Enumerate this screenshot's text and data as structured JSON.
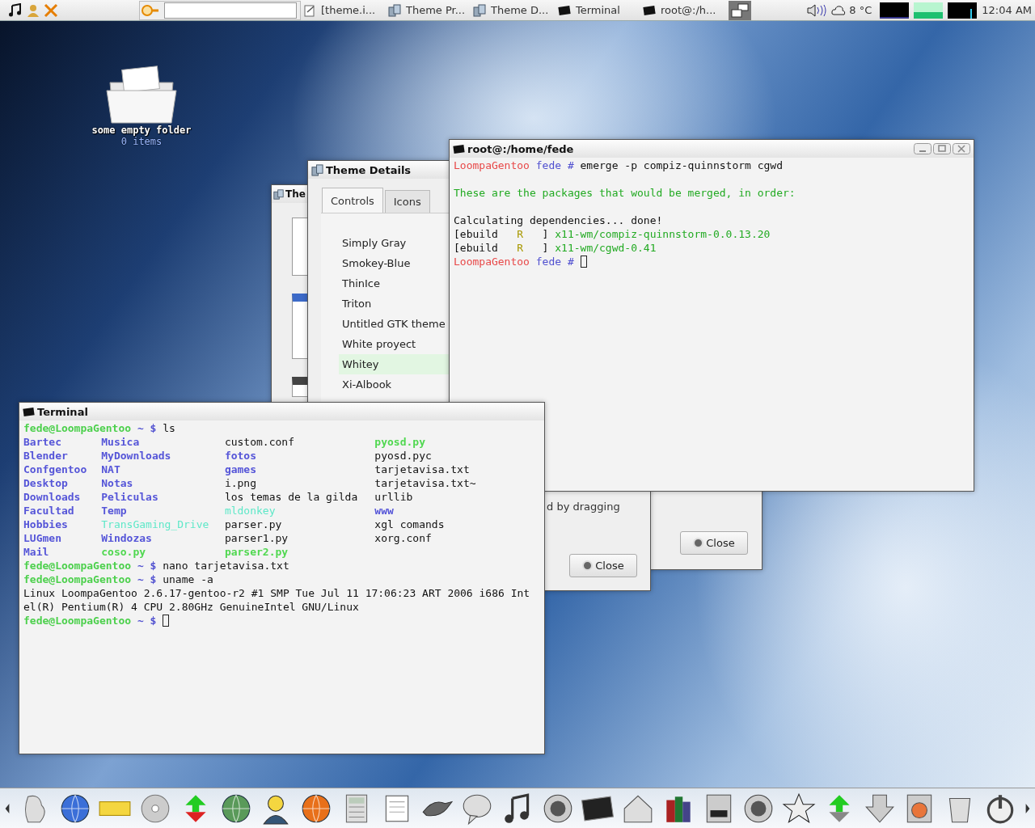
{
  "top_panel": {
    "tasks": [
      {
        "label": "[theme.i..."
      },
      {
        "label": "Theme Pr..."
      },
      {
        "label": "Theme D..."
      },
      {
        "label": "Terminal"
      },
      {
        "label": "root@:/h..."
      }
    ],
    "weather": "8 °C",
    "clock": "12:04 AM"
  },
  "desktop_icons": [
    {
      "label": "some empty folder",
      "detail": "0 items"
    }
  ],
  "theme_properties_window": {
    "title": "The",
    "close_button": "Close"
  },
  "theme_details_window": {
    "title": "Theme Details",
    "tabs": [
      {
        "label": "Controls",
        "selected": true
      },
      {
        "label": "Icons",
        "selected": false
      }
    ],
    "themes": [
      {
        "name": "Simply Gray",
        "selected": false
      },
      {
        "name": "Smokey-Blue",
        "selected": false
      },
      {
        "name": "ThinIce",
        "selected": false
      },
      {
        "name": "Triton",
        "selected": false
      },
      {
        "name": "Untitled GTK theme",
        "selected": false
      },
      {
        "name": "White proyect",
        "selected": false
      },
      {
        "name": "Whitey",
        "selected": true
      },
      {
        "name": "Xi-Albook",
        "selected": false
      }
    ],
    "note_fragment": "d by dragging",
    "close_button": "Close"
  },
  "root_terminal": {
    "title": "root@:/home/fede",
    "lines": [
      {
        "kind": "text",
        "segs": [
          {
            "text": "LoompaGentoo",
            "kind": "host"
          },
          {
            "text": " fede # ",
            "kind": "path"
          },
          {
            "text": "emerge -p compiz-quinnstorm cgwd",
            "kind": "plain"
          }
        ]
      },
      {
        "kind": "blank"
      },
      {
        "kind": "text",
        "segs": [
          {
            "text": "These are the packages that would be merged, in order:",
            "kind": "info"
          }
        ]
      },
      {
        "kind": "blank"
      },
      {
        "kind": "text",
        "segs": [
          {
            "text": "Calculating dependencies... done!",
            "kind": "plain"
          }
        ]
      },
      {
        "kind": "text",
        "segs": [
          {
            "text": "[ebuild   ",
            "kind": "plain"
          },
          {
            "text": "R",
            "kind": "flag"
          },
          {
            "text": "   ] ",
            "kind": "plain"
          },
          {
            "text": "x11-wm/compiz-quinnstorm-0.0.13.20",
            "kind": "pkg"
          }
        ]
      },
      {
        "kind": "text",
        "segs": [
          {
            "text": "[ebuild   ",
            "kind": "plain"
          },
          {
            "text": "R",
            "kind": "flag"
          },
          {
            "text": "   ] ",
            "kind": "plain"
          },
          {
            "text": "x11-wm/cgwd-0.41",
            "kind": "pkg"
          }
        ]
      },
      {
        "kind": "text",
        "cursor": true,
        "segs": [
          {
            "text": "LoompaGentoo",
            "kind": "host"
          },
          {
            "text": " fede # ",
            "kind": "path"
          }
        ]
      }
    ]
  },
  "terminal": {
    "title": "Terminal",
    "lines": [
      {
        "kind": "text",
        "segs": [
          {
            "text": "fede@LoompaGentoo",
            "kind": "user"
          },
          {
            "text": " ~ $ ",
            "kind": "sym"
          },
          {
            "text": "ls",
            "kind": "plain"
          }
        ]
      },
      {
        "kind": "columns",
        "cells": [
          {
            "text": "Bartec",
            "kind": "dir"
          },
          {
            "text": "Musica",
            "kind": "dir"
          },
          {
            "text": "custom.conf",
            "kind": "plain"
          },
          {
            "text": "pyosd.py",
            "kind": "exec"
          }
        ]
      },
      {
        "kind": "columns",
        "cells": [
          {
            "text": "Blender",
            "kind": "dir"
          },
          {
            "text": "MyDownloads",
            "kind": "dir"
          },
          {
            "text": "fotos",
            "kind": "dir"
          },
          {
            "text": "pyosd.pyc",
            "kind": "plain"
          }
        ]
      },
      {
        "kind": "columns",
        "cells": [
          {
            "text": "Confgentoo",
            "kind": "dir"
          },
          {
            "text": "NAT",
            "kind": "dir"
          },
          {
            "text": "games",
            "kind": "dir"
          },
          {
            "text": "tarjetavisa.txt",
            "kind": "plain"
          }
        ]
      },
      {
        "kind": "columns",
        "cells": [
          {
            "text": "Desktop",
            "kind": "dir"
          },
          {
            "text": "Notas",
            "kind": "dir"
          },
          {
            "text": "i.png",
            "kind": "plain"
          },
          {
            "text": "tarjetavisa.txt~",
            "kind": "plain"
          }
        ]
      },
      {
        "kind": "columns",
        "cells": [
          {
            "text": "Downloads",
            "kind": "dir"
          },
          {
            "text": "Peliculas",
            "kind": "dir"
          },
          {
            "text": "los temas de la gilda",
            "kind": "plain"
          },
          {
            "text": "urllib",
            "kind": "plain"
          }
        ]
      },
      {
        "kind": "columns",
        "cells": [
          {
            "text": "Facultad",
            "kind": "dir"
          },
          {
            "text": "Temp",
            "kind": "dir"
          },
          {
            "text": "mldonkey",
            "kind": "link"
          },
          {
            "text": "www",
            "kind": "dir"
          }
        ]
      },
      {
        "kind": "columns",
        "cells": [
          {
            "text": "Hobbies",
            "kind": "dir"
          },
          {
            "text": "TransGaming_Drive",
            "kind": "link"
          },
          {
            "text": "parser.py",
            "kind": "plain"
          },
          {
            "text": "xgl comands",
            "kind": "plain"
          }
        ]
      },
      {
        "kind": "columns",
        "cells": [
          {
            "text": "LUGmen",
            "kind": "dir"
          },
          {
            "text": "Windozas",
            "kind": "dir"
          },
          {
            "text": "parser1.py",
            "kind": "plain"
          },
          {
            "text": "xorg.conf",
            "kind": "plain"
          }
        ]
      },
      {
        "kind": "columns",
        "cells": [
          {
            "text": "Mail",
            "kind": "dir"
          },
          {
            "text": "coso.py",
            "kind": "exec"
          },
          {
            "text": "parser2.py",
            "kind": "exec"
          }
        ]
      },
      {
        "kind": "text",
        "segs": [
          {
            "text": "fede@LoompaGentoo",
            "kind": "user"
          },
          {
            "text": " ~ $ ",
            "kind": "sym"
          },
          {
            "text": "nano tarjetavisa.txt",
            "kind": "plain"
          }
        ]
      },
      {
        "kind": "text",
        "segs": [
          {
            "text": "fede@LoompaGentoo",
            "kind": "user"
          },
          {
            "text": " ~ $ ",
            "kind": "sym"
          },
          {
            "text": "uname -a",
            "kind": "plain"
          }
        ]
      },
      {
        "kind": "text",
        "segs": [
          {
            "text": "Linux LoompaGentoo 2.6.17-gentoo-r2 #1 SMP Tue Jul 11 17:06:23 ART 2006 i686 Int",
            "kind": "plain"
          }
        ]
      },
      {
        "kind": "text",
        "segs": [
          {
            "text": "el(R) Pentium(R) 4 CPU 2.80GHz GenuineIntel GNU/Linux",
            "kind": "plain"
          }
        ]
      },
      {
        "kind": "text",
        "cursor": true,
        "segs": [
          {
            "text": "fede@LoompaGentoo",
            "kind": "user"
          },
          {
            "text": " ~ $ ",
            "kind": "sym"
          }
        ]
      }
    ]
  }
}
